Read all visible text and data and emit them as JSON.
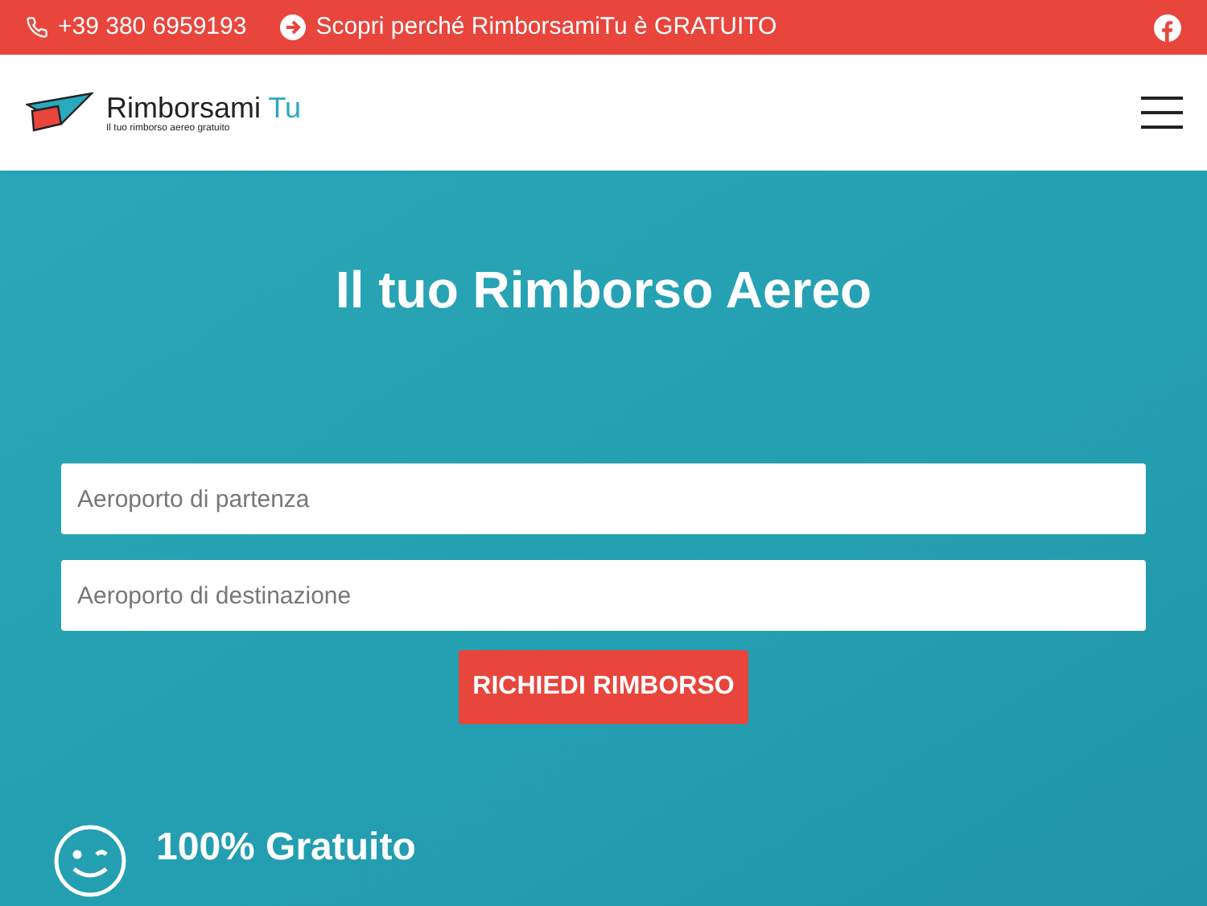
{
  "top_bar": {
    "phone": "+39 380 6959193",
    "promo_link": "Scopri perché RimborsamiTu è GRATUITO"
  },
  "header": {
    "logo_name": "Rimborsami",
    "logo_accent": "Tu",
    "logo_tagline": "Il tuo rimborso aereo gratuito"
  },
  "hero": {
    "title": "Il tuo Rimborso Aereo",
    "fields": [
      {
        "placeholder": "Aeroporto di partenza"
      },
      {
        "placeholder": "Aeroporto di destinazione"
      }
    ],
    "submit_button": "RICHIEDI RIMBORSO",
    "feature": {
      "title": "100% Gratuito"
    }
  }
}
